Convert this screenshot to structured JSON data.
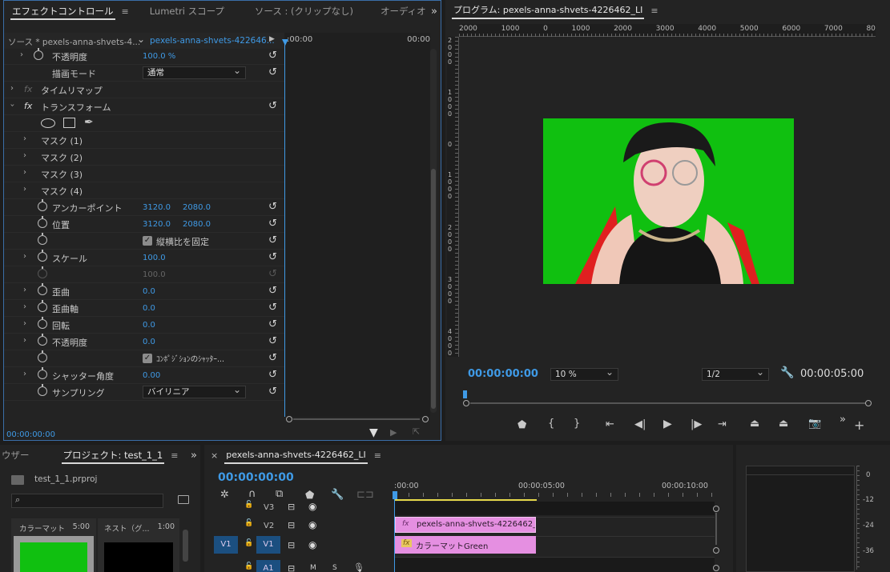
{
  "effects_panel": {
    "tabs": [
      "エフェクトコントロール",
      "Lumetri スコープ",
      "ソース : (クリップなし)",
      "オーディオ"
    ],
    "source_label": "ソース * pexels-anna-shvets-4...",
    "clip_label": "pexels-anna-shvets-422646...",
    "time_start": ":00:00",
    "time_end": "00:00",
    "footer_time": "00:00:00:00",
    "rows": [
      {
        "label": "不透明度",
        "v1": "100.0 %"
      },
      {
        "label": "描画モード",
        "dropdown": "通常"
      },
      {
        "label": "タイムリマップ"
      },
      {
        "label": "トランスフォーム"
      },
      {
        "label": "マスク (1)"
      },
      {
        "label": "マスク (2)"
      },
      {
        "label": "マスク (3)"
      },
      {
        "label": "マスク (4)"
      },
      {
        "label": "アンカーポイント",
        "v1": "3120.0",
        "v2": "2080.0"
      },
      {
        "label": "位置",
        "v1": "3120.0",
        "v2": "2080.0"
      },
      {
        "label": "縦横比を固定"
      },
      {
        "label": "スケール",
        "v1": "100.0"
      },
      {
        "v1": "100.0"
      },
      {
        "label": "歪曲",
        "v1": "0.0"
      },
      {
        "label": "歪曲軸",
        "v1": "0.0"
      },
      {
        "label": "回転",
        "v1": "0.0"
      },
      {
        "label": "不透明度",
        "v1": "0.0"
      },
      {
        "label": "ｺﾝﾎﾟｼﾞｼｮﾝのｼｬｯﾀｰ..."
      },
      {
        "label": "シャッター角度",
        "v1": "0.00"
      },
      {
        "label": "サンプリング",
        "dropdown": "バイリニア"
      }
    ],
    "fx_glyph": "fx"
  },
  "program_monitor": {
    "title": "プログラム: pexels-anna-shvets-4226462_LI",
    "ruler_labels": [
      "2000",
      "1000",
      "0",
      "1000",
      "2000",
      "3000",
      "4000",
      "5000",
      "6000",
      "7000",
      "80"
    ],
    "vruler_labels": [
      "2 0 0 0",
      "1 0 0 0",
      "0",
      "1 0 0 0",
      "2 0 0 0",
      "3 0 0 0",
      "4 0 0 0"
    ],
    "timecode": "00:00:00:00",
    "zoom": "10 %",
    "resolution": "1/2",
    "duration": "00:00:05:00",
    "key_color": "#10c010"
  },
  "project_panel": {
    "tabs": [
      "ウザー",
      "プロジェクト: test_1_1"
    ],
    "file": "test_1_1.prproj",
    "items": [
      {
        "name": "カラーマット",
        "duration": "5:00"
      },
      {
        "name": "ネスト（グ...",
        "duration": "1:00"
      }
    ]
  },
  "timeline": {
    "title": "pexels-anna-shvets-4226462_LI",
    "timecode": "00:00:00:00",
    "ruler": [
      ":00:00",
      "00:00:05:00",
      "00:00:10:00"
    ],
    "tracks": [
      "V3",
      "V2",
      "V1",
      "A1"
    ],
    "source_patch": "V1",
    "mute_label": "M",
    "solo_label": "S",
    "clip_v2": "pexels-anna-shvets-4226462_LI.",
    "clip_v1": "カラーマットGreen",
    "clip_fx": "fx",
    "clip_color": "#e58fe1"
  },
  "audio_meter": {
    "labels": [
      "0",
      "-12",
      "-24",
      "-36"
    ]
  }
}
